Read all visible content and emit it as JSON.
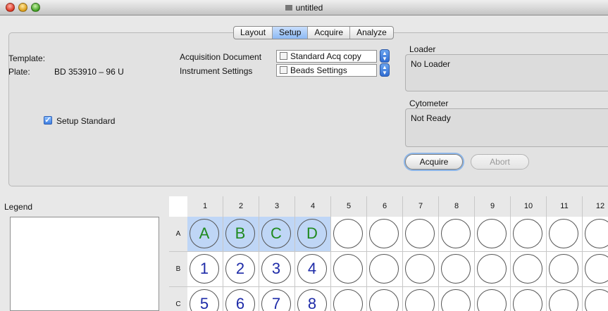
{
  "window": {
    "title": "untitled"
  },
  "tabs": [
    {
      "label": "Layout"
    },
    {
      "label": "Setup"
    },
    {
      "label": "Acquire"
    },
    {
      "label": "Analyze"
    }
  ],
  "setup": {
    "template_label": "Template:",
    "plate_label": "Plate:",
    "plate_value": "BD 353910 – 96 U",
    "acq_doc_label": "Acquisition Document",
    "acq_doc_value": "Standard Acq copy",
    "inst_settings_label": "Instrument Settings",
    "inst_settings_value": "Beads Settings",
    "setup_standard_label": "Setup Standard",
    "setup_standard_checked": true
  },
  "loader": {
    "title": "Loader",
    "value": "No Loader"
  },
  "cytometer": {
    "title": "Cytometer",
    "value": "Not Ready"
  },
  "buttons": {
    "acquire": "Acquire",
    "abort": "Abort"
  },
  "legend": {
    "title": "Legend"
  },
  "plate": {
    "columns": [
      "1",
      "2",
      "3",
      "4",
      "5",
      "6",
      "7",
      "8",
      "9",
      "10",
      "11",
      "12"
    ],
    "rows": [
      {
        "label": "A",
        "wells": [
          "A",
          "B",
          "C",
          "D",
          "",
          "",
          "",
          "",
          "",
          "",
          "",
          ""
        ],
        "selected": [
          true,
          true,
          true,
          true,
          false,
          false,
          false,
          false,
          false,
          false,
          false,
          false
        ],
        "color": "green"
      },
      {
        "label": "B",
        "wells": [
          "1",
          "2",
          "3",
          "4",
          "",
          "",
          "",
          "",
          "",
          "",
          "",
          ""
        ],
        "selected": [
          false,
          false,
          false,
          false,
          false,
          false,
          false,
          false,
          false,
          false,
          false,
          false
        ],
        "color": "blue"
      },
      {
        "label": "C",
        "wells": [
          "5",
          "6",
          "7",
          "8",
          "",
          "",
          "",
          "",
          "",
          "",
          "",
          ""
        ],
        "selected": [
          false,
          false,
          false,
          false,
          false,
          false,
          false,
          false,
          false,
          false,
          false,
          false
        ],
        "color": "blue"
      }
    ]
  },
  "colors": {
    "selection": "#bfd6f6",
    "active_tab": "#8cb9f4",
    "letter_well": "#1f8a1f",
    "number_well": "#1e2ba8"
  }
}
